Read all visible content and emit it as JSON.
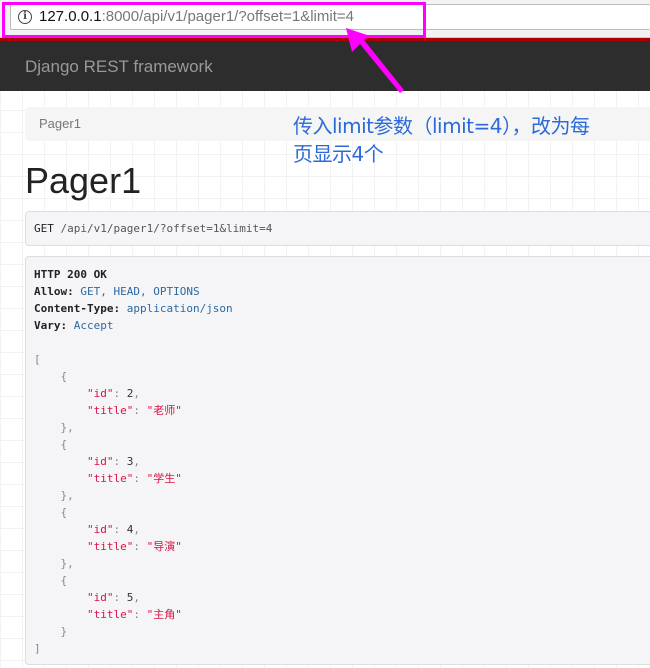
{
  "browser": {
    "url_host": "127.0.0.1",
    "url_rest": ":8000/api/v1/pager1/?offset=1&limit=4",
    "info_icon": "i"
  },
  "navbar": {
    "brand": "Django REST framework"
  },
  "breadcrumb": {
    "item": "Pager1"
  },
  "annotation": {
    "line1": "传入limit参数（limit=4），改为每",
    "line2": "页显示4个",
    "color": "#2b6ad8"
  },
  "page": {
    "title": "Pager1"
  },
  "request": {
    "method": "GET",
    "path": "/api/v1/pager1/?offset=1&limit=4"
  },
  "response": {
    "status": "HTTP 200 OK",
    "headers": [
      {
        "k": "Allow:",
        "v": "GET, HEAD, OPTIONS"
      },
      {
        "k": "Content-Type:",
        "v": "application/json"
      },
      {
        "k": "Vary:",
        "v": "Accept"
      }
    ],
    "items": [
      {
        "id": 2,
        "title": "老师"
      },
      {
        "id": 3,
        "title": "学生"
      },
      {
        "id": 4,
        "title": "导演"
      },
      {
        "id": 5,
        "title": "主角"
      }
    ]
  }
}
